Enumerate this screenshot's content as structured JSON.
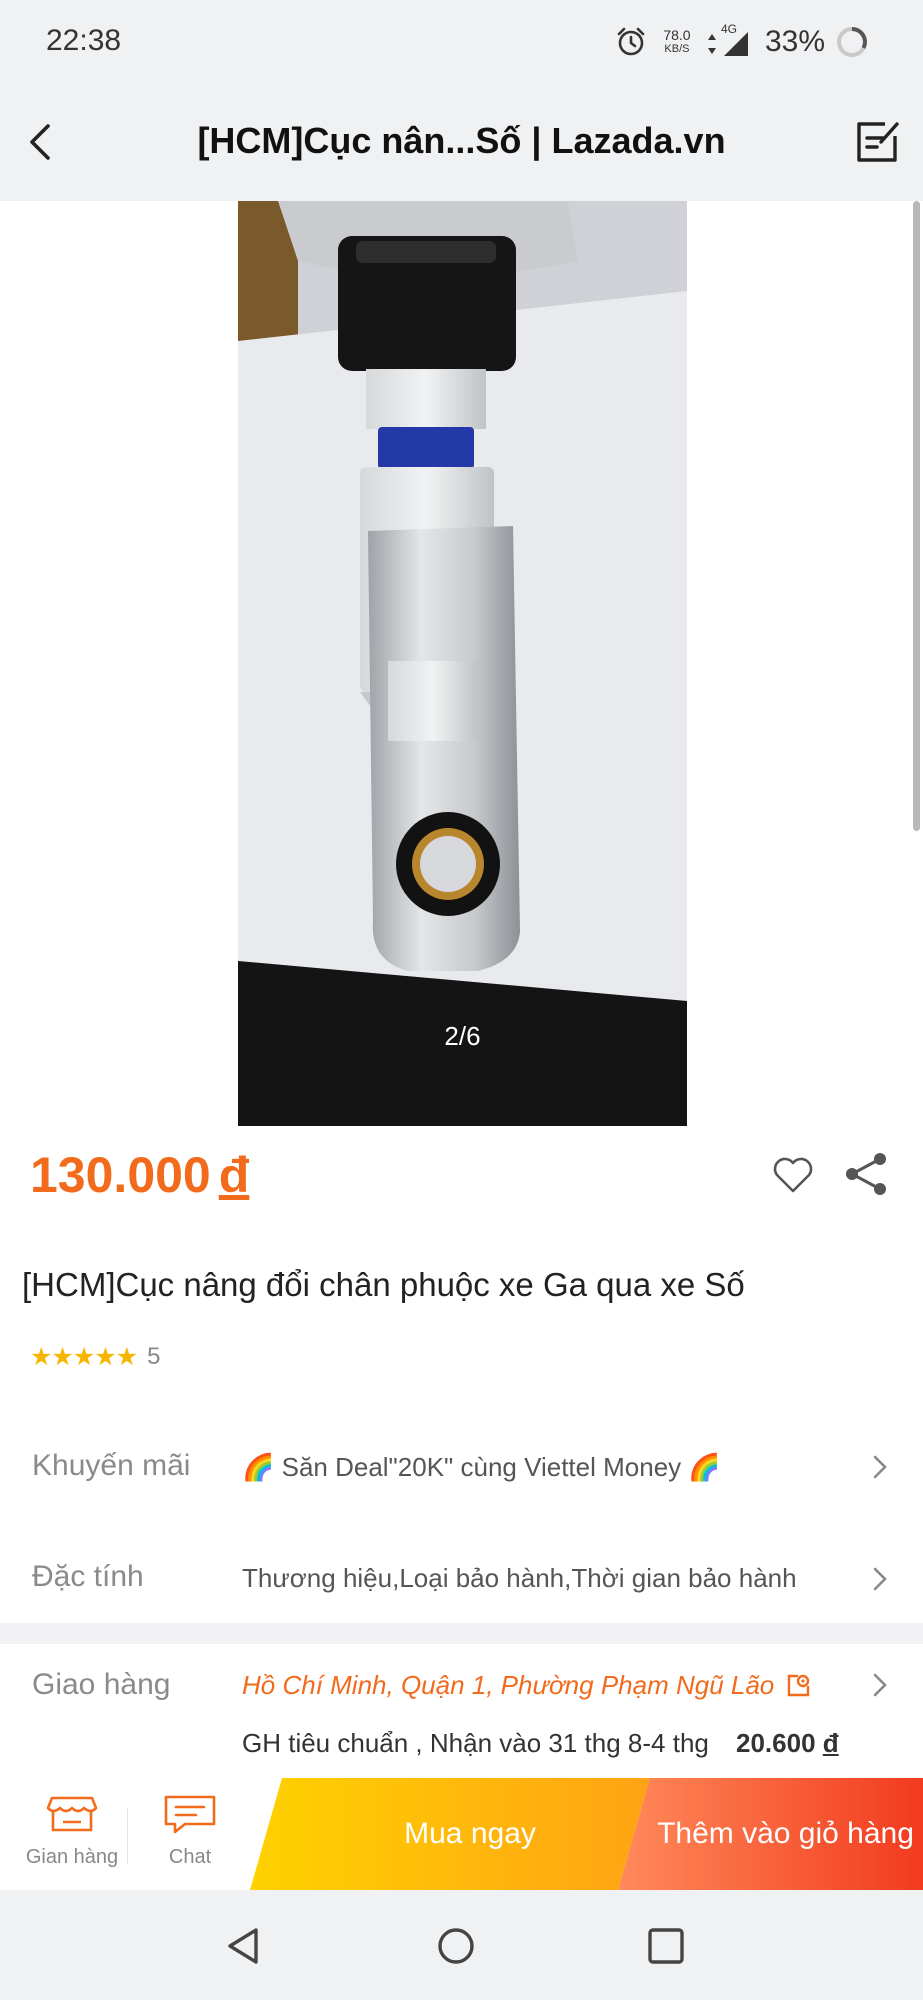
{
  "status_bar": {
    "time": "22:38",
    "speed_value": "78.0",
    "speed_unit": "KB/S",
    "network": "4G",
    "battery": "33%",
    "icons": [
      "alarm-icon",
      "data-arrows-icon",
      "signal-icon",
      "battery-ring-icon"
    ]
  },
  "header": {
    "title": "[HCM]Cục nân...Số | Lazada.vn",
    "icons": [
      "back-arrow-icon",
      "edit-note-icon"
    ]
  },
  "gallery": {
    "counter": "2/6"
  },
  "product": {
    "price": "130.000",
    "currency": "đ",
    "name": "[HCM]Cục nâng đổi chân phuộc xe Ga qua xe Số",
    "stars": "★★★★★",
    "rating_count": "5",
    "accent_color": "#f26b1d",
    "star_color": "#f7b500"
  },
  "rows": {
    "promo": {
      "label": "Khuyến mãi",
      "value": "🌈 Săn Deal\"20K\" cùng Viettel Money 🌈"
    },
    "spec": {
      "label": "Đặc tính",
      "value": "Thương hiệu,Loại bảo hành,Thời gian bảo hành"
    },
    "shipping": {
      "label": "Giao hàng",
      "location": "Hồ Chí Minh, Quận 1, Phường Phạm Ngũ Lão",
      "detail": "GH tiêu chuẩn , Nhận vào 31 thg 8-4 thg",
      "fee": "20.600",
      "currency": "đ"
    }
  },
  "action_bar": {
    "shop_label": "Gian hàng",
    "chat_label": "Chat",
    "buy_label": "Mua ngay",
    "cart_label": "Thêm vào giỏ hàng"
  }
}
